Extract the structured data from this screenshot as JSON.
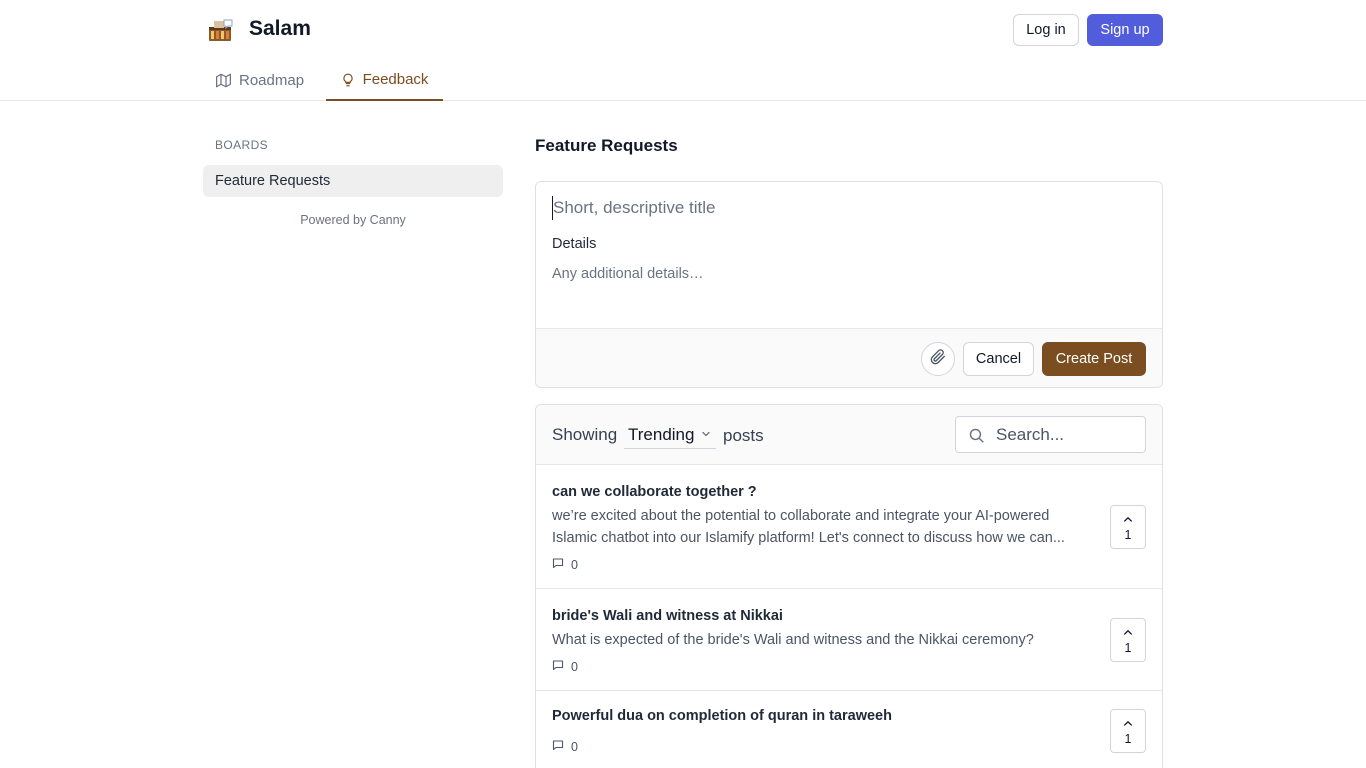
{
  "header": {
    "app_title": "Salam",
    "login_label": "Log in",
    "signup_label": "Sign up",
    "accent_color": "#525ddc"
  },
  "tabs": [
    {
      "label": "Roadmap",
      "icon": "map-icon",
      "active": false
    },
    {
      "label": "Feedback",
      "icon": "lightbulb-icon",
      "active": true
    }
  ],
  "sidebar": {
    "section_label": "BOARDS",
    "boards": [
      {
        "label": "Feature Requests",
        "selected": true
      }
    ],
    "powered_by": "Powered by Canny"
  },
  "main": {
    "board_title": "Feature Requests",
    "form": {
      "title_placeholder": "Short, descriptive title",
      "title_value": "",
      "details_label": "Details",
      "details_placeholder": "Any additional details…",
      "details_value": "",
      "cancel_label": "Cancel",
      "create_label": "Create Post",
      "brand_color": "#7a4e21"
    },
    "filter": {
      "showing_label": "Showing",
      "sort_value": "Trending",
      "posts_label": "posts",
      "search_placeholder": "Search..."
    },
    "posts": [
      {
        "title": "can we collaborate together ?",
        "description": "we’re excited about the potential to collaborate and integrate your AI-powered Islamic chatbot into our Islamify platform! Let's connect to discuss how we can...",
        "comments": "0",
        "votes": "1"
      },
      {
        "title": "bride's Wali and witness at Nikkai",
        "description": "What is expected of the bride's Wali and witness and the Nikkai ceremony?",
        "comments": "0",
        "votes": "1"
      },
      {
        "title": "Powerful dua on completion of quran in taraweeh",
        "description": "",
        "comments": "0",
        "votes": "1"
      }
    ]
  }
}
